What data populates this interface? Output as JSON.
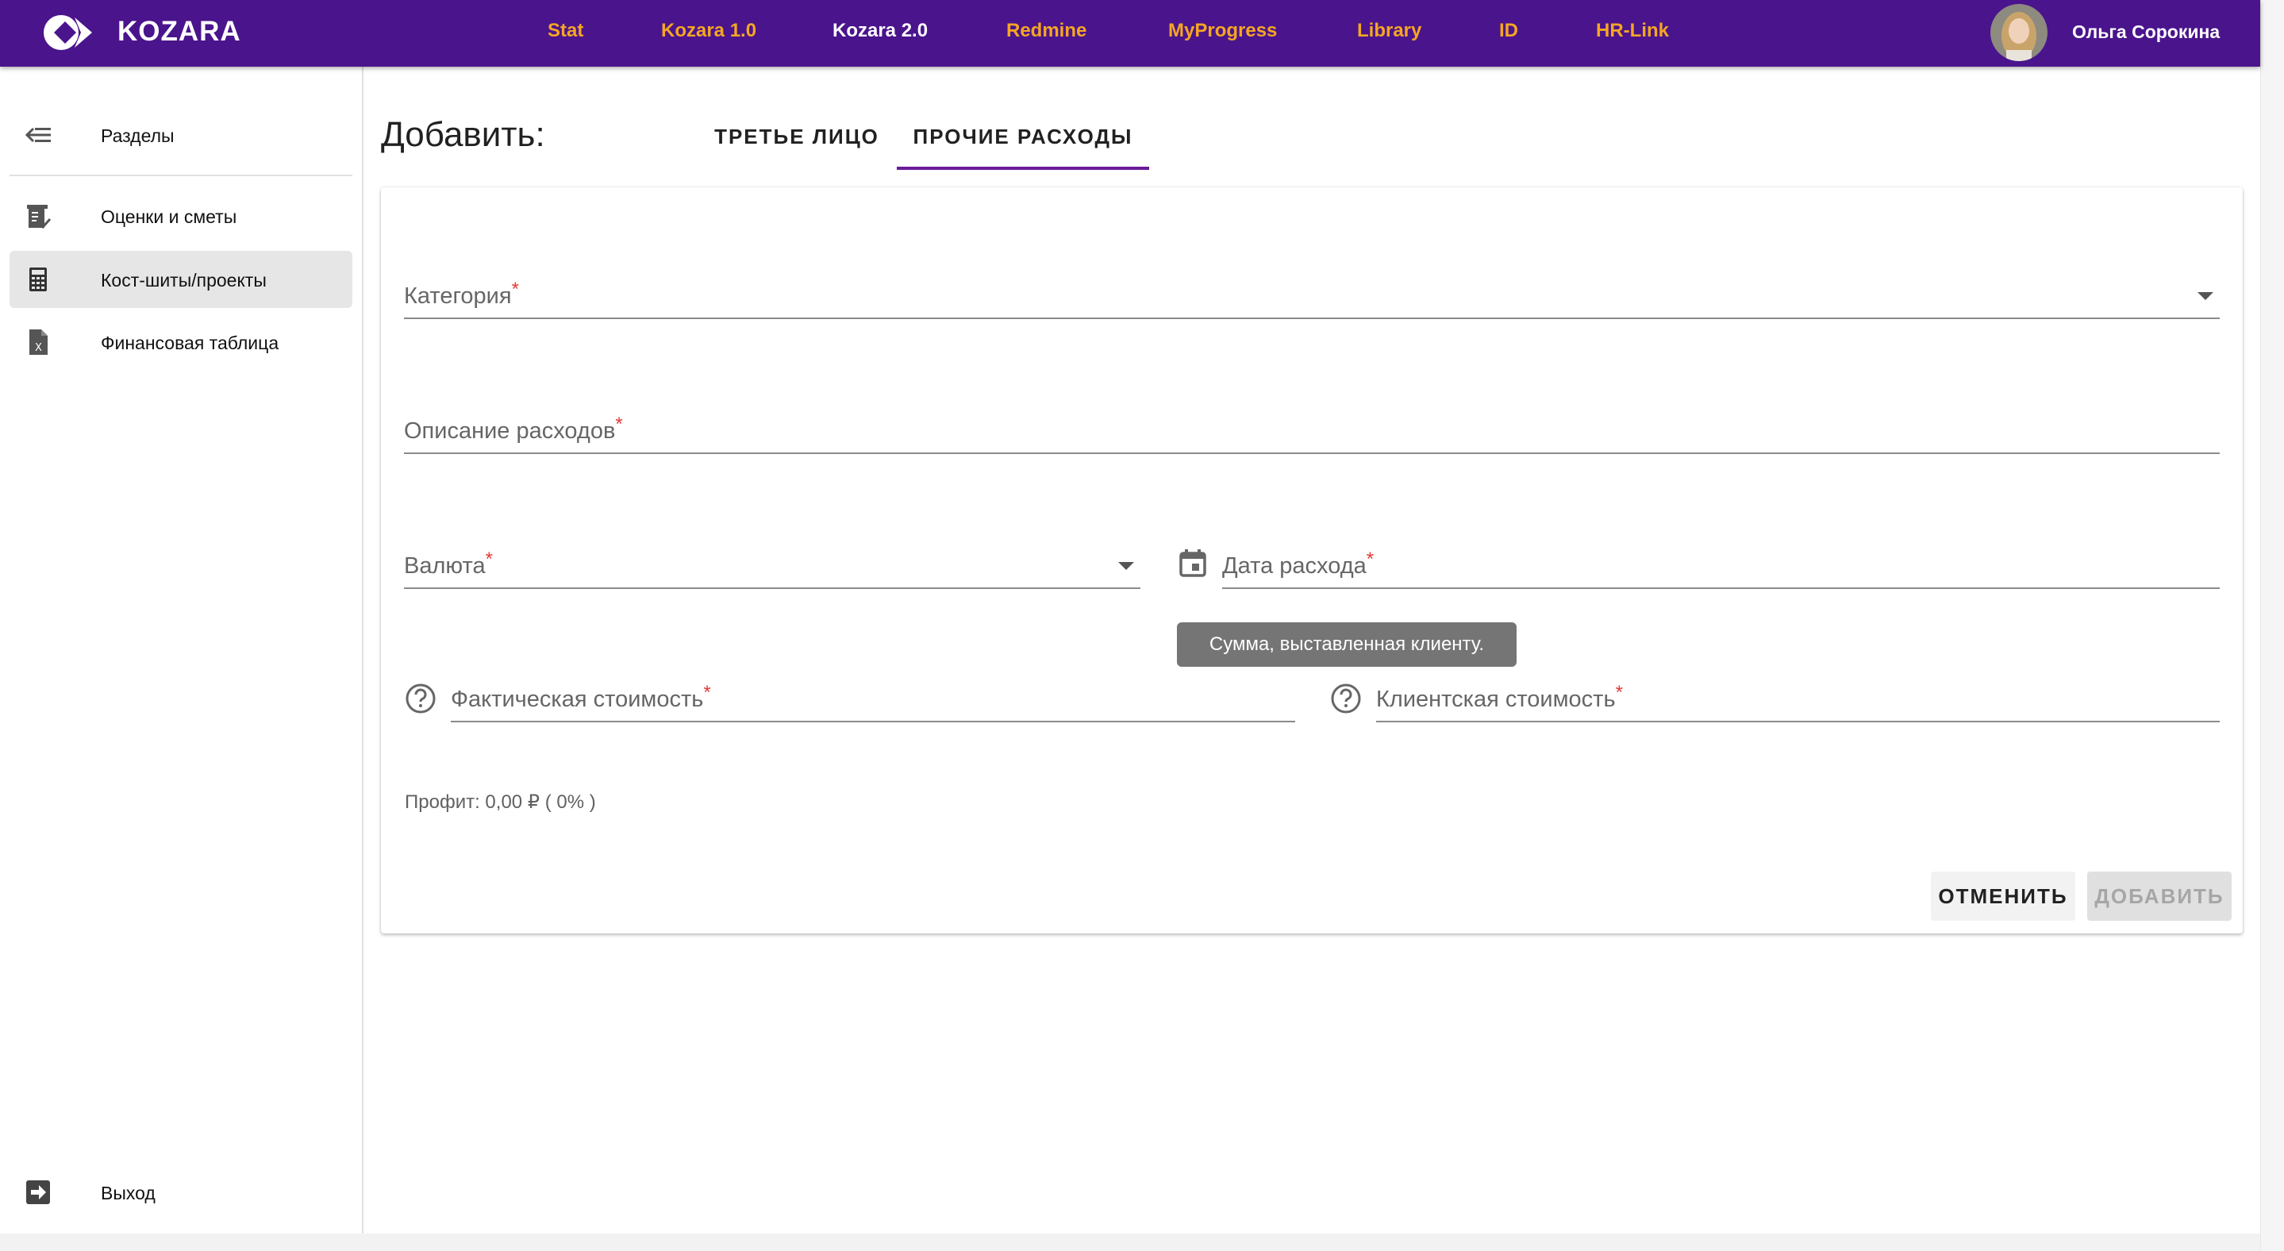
{
  "app": {
    "brand": "KOZARA",
    "colors": {
      "topbar": "#4a148c",
      "nav_link": "#f5a623",
      "tab_indicator": "#6a1b9a",
      "required": "#e53935"
    }
  },
  "nav": {
    "links": [
      "Stat",
      "Kozara 1.0",
      "Kozara 2.0",
      "Redmine",
      "MyProgress",
      "Library",
      "ID",
      "HR-Link"
    ],
    "active": "Kozara 2.0"
  },
  "user": {
    "name": "Ольга Сорокина"
  },
  "sidebar": {
    "header": {
      "label": "Разделы",
      "icon": "collapse-menu-icon"
    },
    "items": [
      {
        "label": "Оценки и сметы",
        "icon": "estimate-list-icon"
      },
      {
        "label": "Кост-шиты/проекты",
        "icon": "calculator-icon",
        "selected": true
      },
      {
        "label": "Финансовая таблица",
        "icon": "spreadsheet-file-icon"
      }
    ],
    "logout": {
      "label": "Выход",
      "icon": "logout-icon"
    }
  },
  "main": {
    "title": "Добавить:",
    "tabs": [
      {
        "label": "ТРЕТЬЕ ЛИЦО",
        "active": false
      },
      {
        "label": "ПРОЧИЕ РАСХОДЫ",
        "active": true
      }
    ]
  },
  "form": {
    "required_mark": "*",
    "category": {
      "label": "Категория",
      "value": ""
    },
    "description": {
      "label": "Описание расходов",
      "value": ""
    },
    "currency": {
      "label": "Валюта",
      "value": ""
    },
    "date": {
      "label": "Дата расхода",
      "value": ""
    },
    "actual_cost": {
      "label": "Фактическая стоимость",
      "value": ""
    },
    "client_cost": {
      "label": "Клиентская стоимость",
      "value": ""
    },
    "tooltip": "Сумма, выставленная клиенту.",
    "profit": "Профит: 0,00 ₽ ( 0% )",
    "cancel_label": "ОТМЕНИТЬ",
    "add_label": "ДОБАВИТЬ"
  }
}
